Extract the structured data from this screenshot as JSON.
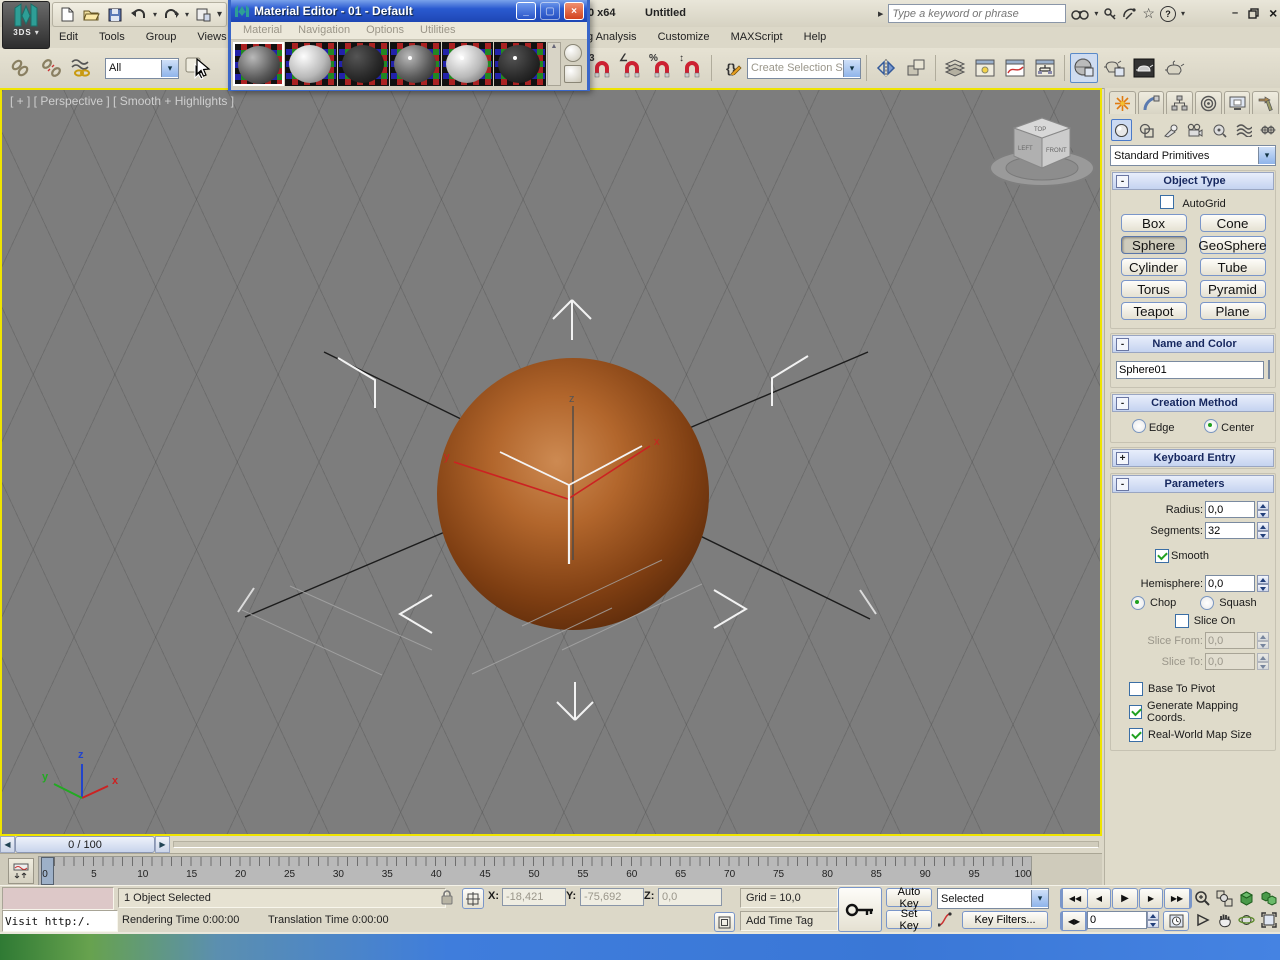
{
  "titlebar": {
    "app_label": "3DS",
    "title_fragment": "0 x64",
    "doc_title": "Untitled",
    "search_placeholder": "Type a keyword or phrase"
  },
  "menubar": {
    "left": [
      "Edit",
      "Tools",
      "Group",
      "Views"
    ],
    "right": [
      "g Analysis",
      "Customize",
      "MAXScript",
      "Help"
    ]
  },
  "toolbar": {
    "filter_value": "All",
    "selection_set_placeholder": "Create Selection Se"
  },
  "material_editor": {
    "title": "Material Editor - 01 - Default",
    "menus": [
      "Material",
      "Navigation",
      "Options",
      "Utilities"
    ]
  },
  "viewport": {
    "label": "[ + ] [ Perspective ] [ Smooth + Highlights ]",
    "viewcube": {
      "top": "TOP",
      "left": "LEFT",
      "front": "FRONT"
    },
    "world_axis": {
      "x": "x",
      "y": "y",
      "z": "z"
    },
    "gizmo": {
      "x": "x",
      "y": "y",
      "z": "z"
    }
  },
  "command_panel": {
    "category_dropdown": "Standard Primitives",
    "object_type": {
      "title": "Object Type",
      "collapse": "-",
      "autogrid": "AutoGrid",
      "buttons": [
        "Box",
        "Cone",
        "Sphere",
        "GeoSphere",
        "Cylinder",
        "Tube",
        "Torus",
        "Pyramid",
        "Teapot",
        "Plane"
      ]
    },
    "name_color": {
      "title": "Name and Color",
      "collapse": "-",
      "name_value": "Sphere01"
    },
    "creation": {
      "title": "Creation Method",
      "collapse": "-",
      "edge": "Edge",
      "center": "Center"
    },
    "keyboard": {
      "title": "Keyboard Entry",
      "collapse": "+"
    },
    "parameters": {
      "title": "Parameters",
      "collapse": "-",
      "radius_label": "Radius:",
      "radius_value": "0,0",
      "segments_label": "Segments:",
      "segments_value": "32",
      "smooth": "Smooth",
      "hemisphere_label": "Hemisphere:",
      "hemisphere_value": "0,0",
      "chop": "Chop",
      "squash": "Squash",
      "slice_on": "Slice On",
      "slice_from_label": "Slice From:",
      "slice_from_value": "0,0",
      "slice_to_label": "Slice To:",
      "slice_to_value": "0,0",
      "base_to_pivot": "Base To Pivot",
      "generate_mapping": "Generate Mapping Coords.",
      "real_world": "Real-World Map Size"
    }
  },
  "timeline": {
    "slider_label": "0 / 100",
    "tick_labels": [
      0,
      5,
      10,
      15,
      20,
      25,
      30,
      35,
      40,
      45,
      50,
      55,
      60,
      65,
      70,
      75,
      80,
      85,
      90,
      95,
      100
    ]
  },
  "status": {
    "listener_line": "Visit http:/.",
    "selection": "1 Object Selected",
    "rendering_time": "Rendering Time  0:00:00",
    "translation_time": "Translation Time  0:00:00",
    "x_label": "X:",
    "x_value": "-18,421",
    "y_label": "Y:",
    "y_value": "-75,692",
    "z_label": "Z:",
    "z_value": "0,0",
    "grid": "Grid = 10,0",
    "add_time_tag": "Add Time Tag",
    "auto_key": "Auto Key",
    "set_key": "Set Key",
    "key_dropdown": "Selected",
    "key_filters": "Key Filters...",
    "frame": "0"
  },
  "icons": {
    "snap_3d": "3",
    "snap_angle": "∠",
    "snap_percent": "%",
    "snap_spinner": "↕",
    "named_sets": "{}",
    "help": "?",
    "star": "☆",
    "goto_start": "◀◀",
    "prev_frame": "◀",
    "play": "▶",
    "next_frame": "▶",
    "goto_end": "▶▶",
    "key_mode": "◀▶",
    "win_min": "–",
    "win_close": "×",
    "me_min": "_",
    "me_close": "×",
    "slider_prev": "◀",
    "slider_next": "▶",
    "combo_arrow": "▾",
    "search_expand": "▶"
  },
  "colors": {
    "accent_blue": "#2a5ad0",
    "viewport_gray": "#7d7d7d",
    "active_border_yellow": "#efe400",
    "sphere_orange": "#a35a22",
    "axis_x_red": "#cc2222",
    "axis_y_green": "#22aa22",
    "axis_z_blue": "#2244cc"
  }
}
